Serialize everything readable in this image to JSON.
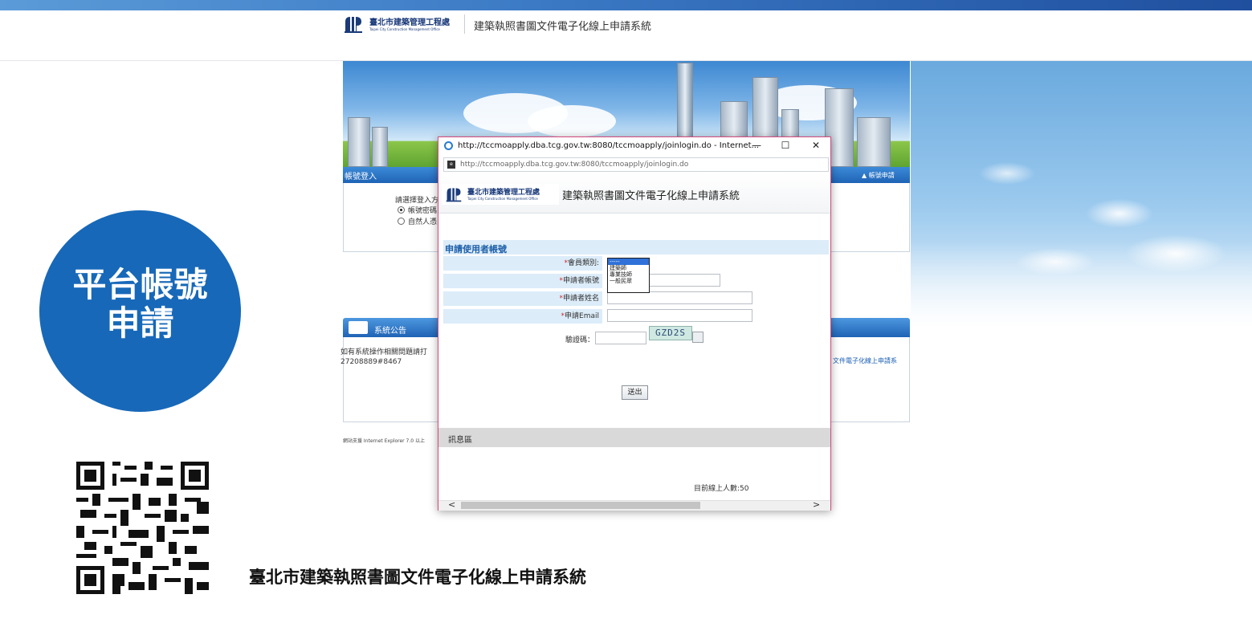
{
  "header": {
    "org_name": "臺北市建築管理工程處",
    "org_name_en": "Taipei City Construction Management Office",
    "system_title": "建築執照書圖文件電子化線上申請系統"
  },
  "login_panel": {
    "title": "帳號登入",
    "right_link": "帳號申請",
    "prompt": "請選擇登入方",
    "options": [
      "帳號密碼",
      "自然人憑"
    ]
  },
  "announcement": {
    "title": "系統公告",
    "body": "如有系統操作相關問題請打 27208889#8467",
    "right_text": "文件電子化線上申請系"
  },
  "ie_note": "網站支援 Internet Explorer 7.0 以上",
  "popup": {
    "window_title": "http://tccmoapply.dba.tcg.gov.tw:8080/tccmoapply/joinlogin.do - Internet...",
    "address": "http://tccmoapply.dba.tcg.gov.tw:8080/tccmoapply/joinlogin.do",
    "org_name": "臺北市建築管理工程處",
    "org_name_en": "Taipei City Construction Management Office",
    "system_title": "建築執照書圖文件電子化線上申請系統",
    "form_title": "申請使用者帳號",
    "fields": {
      "member_type": "會員類別:",
      "account": "申請者帳號",
      "name": "申請者姓名",
      "email": "申請Email"
    },
    "member_type_options": [
      "-----",
      "建築師",
      "專業技師",
      "一般民眾"
    ],
    "captcha_label": "驗證碼：",
    "captcha_code": "GZD2S",
    "submit_label": "送出",
    "message_area": "訊息區",
    "online_count": "目前線上人數:50",
    "window_buttons": {
      "minimize": "—",
      "maximize": "☐",
      "close": "✕"
    }
  },
  "promo": {
    "circle_line1": "平台帳號",
    "circle_line2": "申請",
    "footer_title": "臺北市建築執照書圖文件電子化線上申請系統"
  },
  "colors": {
    "brand_blue": "#1768b8",
    "popup_border": "#d34a7c",
    "form_label_bg": "#dcecf9",
    "required": "#d12a2a"
  }
}
